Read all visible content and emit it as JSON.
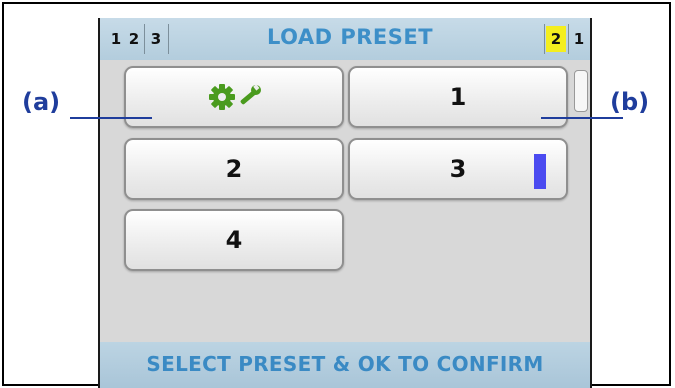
{
  "header": {
    "left_numbers": [
      "1",
      "2",
      "3"
    ],
    "title": "LOAD PRESET",
    "right_numbers": [
      "2",
      "1"
    ],
    "active_right_index": 0
  },
  "presets": [
    {
      "label": "",
      "icon": "settings-icon"
    },
    {
      "label": "1"
    },
    {
      "label": "2"
    },
    {
      "label": "3",
      "indicator": "level-bar"
    },
    {
      "label": "4"
    }
  ],
  "footer": {
    "text": "SELECT PRESET & OK TO CONFIRM"
  },
  "annotations": {
    "a": "(a)",
    "b": "(b)"
  },
  "colors": {
    "title": "#3d8fc8",
    "active_highlight": "#f4ee1e",
    "gear_icon": "#4a9b1e",
    "level_bar": "#4a4af0",
    "annotation": "#1f3d9c"
  }
}
